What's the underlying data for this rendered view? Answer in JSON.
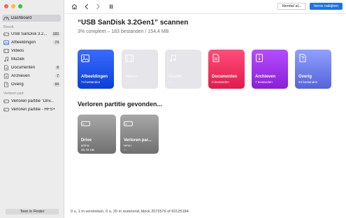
{
  "sidebar": {
    "dashboard_label": "Dashboard",
    "results_header": "Result.",
    "items": [
      {
        "label": "USB  SanDisk 3.2...",
        "count": "183"
      },
      {
        "label": "Afbeeldingen",
        "count": "74"
      },
      {
        "label": "Videos",
        "count": ""
      },
      {
        "label": "Muziek",
        "count": ""
      },
      {
        "label": "Documenten",
        "count": "8"
      },
      {
        "label": "Archieven",
        "count": "7"
      },
      {
        "label": "Overig",
        "count": "94"
      }
    ],
    "lost_header": "Verloren part.",
    "lost_items": [
      {
        "label": "Verloren partitie \"Driv..."
      },
      {
        "label": "Verloren partitie - HFS+"
      }
    ],
    "finder_button": "Toon in Finder"
  },
  "toolbar": {
    "recover_label": "Herstel al...",
    "scan_label": "Items nakijken"
  },
  "main": {
    "title": "“USB  SanDisk 3.2Gen1” scannen",
    "subtitle": "3% compleet – 183 bestanden / 154,4 MB",
    "categories": [
      {
        "name": "Afbeeldingen",
        "sub": "74 bestanden",
        "color_top": "#3a6bff",
        "color_bottom": "#0a3fd6"
      },
      {
        "name": "Videos",
        "sub": "—"
      },
      {
        "name": "Muziek",
        "sub": "—"
      },
      {
        "name": "Documenten",
        "sub": "8 bestanden",
        "color_top": "#ff4d7a",
        "color_bottom": "#e01b4a"
      },
      {
        "name": "Archieven",
        "sub": "7 bestanden",
        "color_top": "#b44dff",
        "color_bottom": "#8b1fd8"
      },
      {
        "name": "Overig",
        "sub": "94 bestanden",
        "color_top": "#8fa0ff",
        "color_bottom": "#5564d8"
      }
    ],
    "lost_title": "Verloren partitie gevonden...",
    "partitions": [
      {
        "name": "Drive",
        "fs": "NTFS",
        "size": "30,78 GB"
      },
      {
        "name": "Verloren par...",
        "fs": "HFS+",
        "size": "—"
      }
    ]
  },
  "status": "0 u, 1 m verstreken, 0 u, 20 m resterend, block 2072576 of 60125184"
}
